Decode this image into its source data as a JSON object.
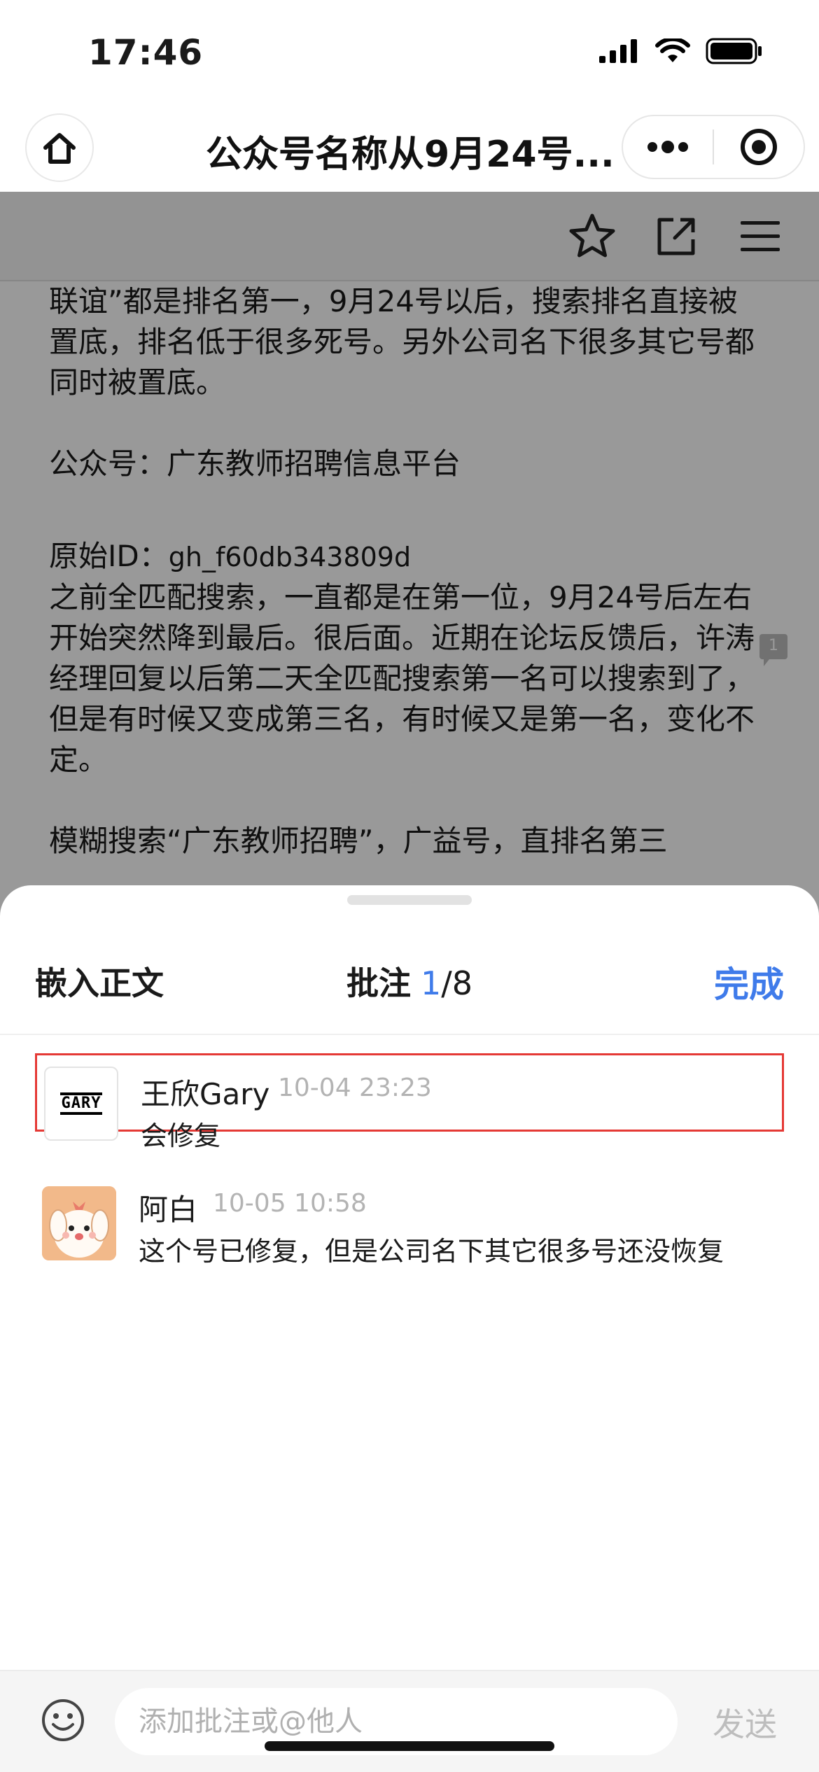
{
  "status_bar": {
    "time": "17:46"
  },
  "nav": {
    "title": "公众号名称从9月24号..."
  },
  "document": {
    "paragraphs": [
      "联谊”都是排名第一，9月24号以后，搜索排名直接被置底，排名低于很多死号。另外公司名下很多其它号都同时被置底。",
      "公众号：广东教师招聘信息平台",
      "之前全匹配搜索，一直都是在第一位，9月24号后左右开始突然降到最后。很后面。近期在论坛反馈后，许涛经理回复以后第二天全匹配搜索第一名可以搜索到了，但是有时候又变成第三名，有时候又是第一名，变化不定。",
      "模糊搜索“广东教师招聘”，广益号，直排名第三"
    ],
    "id_label": "原始ID：",
    "id_value": "gh_f60db343809d",
    "comment_marker_count": "1"
  },
  "sheet": {
    "embed_label": "嵌入正文",
    "title_label": "批注",
    "current": "1",
    "total": "/8",
    "done_label": "完成"
  },
  "comments": [
    {
      "name": "王欣Gary",
      "time": "10-04 23:23",
      "text": "会修复",
      "avatar_text": "GARY"
    },
    {
      "name": "阿白",
      "time": "10-05 10:58",
      "text": "这个号已修复，但是公司名下其它很多号还没恢复"
    }
  ],
  "input": {
    "placeholder": "添加批注或@他人",
    "send_label": "发送"
  },
  "colors": {
    "accent": "#3f7bea",
    "selection_border": "#e53935"
  }
}
